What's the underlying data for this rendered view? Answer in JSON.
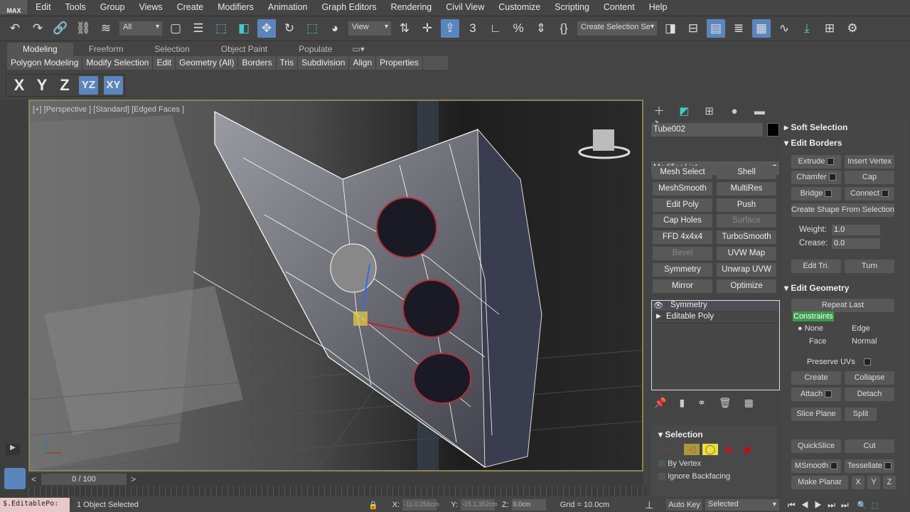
{
  "menubar": {
    "logo": "MAX",
    "items": [
      "Edit",
      "Tools",
      "Group",
      "Views",
      "Create",
      "Modifiers",
      "Animation",
      "Graph Editors",
      "Rendering",
      "Civil View",
      "Customize",
      "Scripting",
      "Content",
      "Help"
    ]
  },
  "toolbar": {
    "filter": "All",
    "ref_coord": "View",
    "selection_set": "Create Selection Se"
  },
  "ribbon": {
    "tabs": [
      "Modeling",
      "Freeform",
      "Selection",
      "Object Paint",
      "Populate"
    ],
    "active_tab": "Modeling",
    "panels": [
      "Polygon Modeling",
      "Modify Selection",
      "Edit",
      "Geometry (All)",
      "Borders",
      "Tris",
      "Subdivision",
      "Align",
      "Properties"
    ]
  },
  "axis_constraints": {
    "items": [
      "X",
      "Y",
      "Z",
      "YZ",
      "XY"
    ],
    "active": "YZ"
  },
  "viewport": {
    "label": "[+] [Perspective ] [Standard] [Edged Faces ]"
  },
  "command_panel": {
    "object_name": "Tube002",
    "object_color": "#000000",
    "modifier_list": "Modifier List",
    "modifier_buttons": [
      {
        "label": "Mesh Select",
        "enabled": true
      },
      {
        "label": "Shell",
        "enabled": true
      },
      {
        "label": "MeshSmooth",
        "enabled": true
      },
      {
        "label": "MultiRes",
        "enabled": true
      },
      {
        "label": "Edit Poly",
        "enabled": true
      },
      {
        "label": "Push",
        "enabled": true
      },
      {
        "label": "Cap Holes",
        "enabled": true
      },
      {
        "label": "Surface",
        "enabled": false
      },
      {
        "label": "FFD 4x4x4",
        "enabled": true
      },
      {
        "label": "TurboSmooth",
        "enabled": true
      },
      {
        "label": "Bevel",
        "enabled": false
      },
      {
        "label": "UVW Map",
        "enabled": true
      },
      {
        "label": "Symmetry",
        "enabled": true
      },
      {
        "label": "Unwrap UVW",
        "enabled": true
      },
      {
        "label": "Mirror",
        "enabled": true
      },
      {
        "label": "Optimize",
        "enabled": true
      }
    ],
    "stack": [
      "Symmetry",
      "Editable Poly"
    ],
    "selection": {
      "title": "Selection",
      "by_vertex": "By Vertex",
      "ignore_backfacing": "Ignore Backfacing"
    }
  },
  "rollouts": {
    "soft_selection": "Soft Selection",
    "edit_borders": {
      "title": "Edit Borders",
      "extrude": "Extrude",
      "insert_vertex": "Insert Vertex",
      "chamfer": "Chamfer",
      "cap": "Cap",
      "bridge": "Bridge",
      "connect": "Connect",
      "create_shape": "Create Shape From Selection",
      "weight_label": "Weight:",
      "weight": "1.0",
      "crease_label": "Crease:",
      "crease": "0.0",
      "edit_tri": "Edit Tri.",
      "turn": "Turn"
    },
    "edit_geometry": {
      "title": "Edit Geometry",
      "repeat_last": "Repeat Last",
      "constraints": "Constraints",
      "none": "None",
      "edge": "Edge",
      "face": "Face",
      "normal": "Normal",
      "preserve_uvs": "Preserve UVs",
      "create": "Create",
      "collapse": "Collapse",
      "attach": "Attach",
      "detach": "Detach",
      "slice_plane": "Slice Plane",
      "split": "Split",
      "quickslice": "QuickSlice",
      "cut": "Cut",
      "msmooth": "MSmooth",
      "tessellate": "Tessellate",
      "make_planar": "Make Planar",
      "x": "X",
      "y": "Y",
      "z": "Z"
    }
  },
  "timeline": {
    "frame": "0 / 100"
  },
  "status": {
    "script": "$.EditablePo:",
    "selected": "1 Object Selected",
    "x_label": "X:",
    "x": "-11.0.256cm",
    "y_label": "Y:",
    "y": "-15.1.352cm",
    "z_label": "Z:",
    "z": "0.0cm",
    "grid": "Grid = 10.0cm",
    "auto_key": "Auto Key",
    "key_mode": "Selected"
  }
}
